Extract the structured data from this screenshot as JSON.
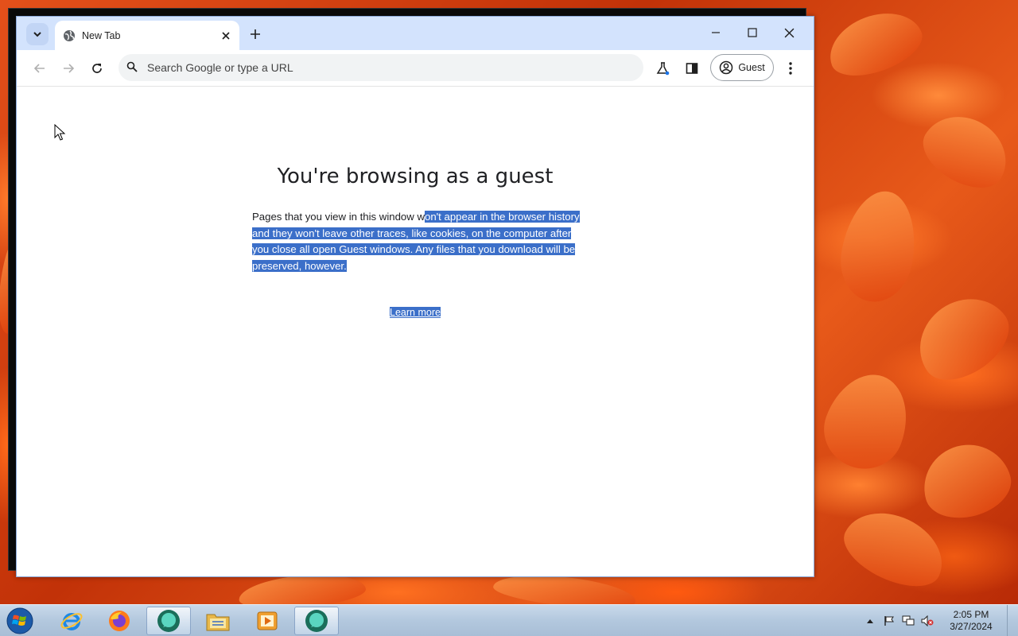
{
  "browser": {
    "tab_title": "New Tab",
    "omnibox_placeholder": "Search Google or type a URL",
    "profile_label": "Guest"
  },
  "page": {
    "heading": "You're browsing as a guest",
    "desc_before": "Pages that you view in this window w",
    "desc_selected": "on't appear in the browser history and they won't leave other traces, like cookies, on the computer after you close all open Guest windows. Any files that you download will be preserved, however.",
    "learn_more": "Learn more"
  },
  "taskbar": {
    "time": "2:05 PM",
    "date": "3/27/2024"
  },
  "colors": {
    "selection": "#3b6fc9",
    "tabbar": "#d3e3fd"
  }
}
